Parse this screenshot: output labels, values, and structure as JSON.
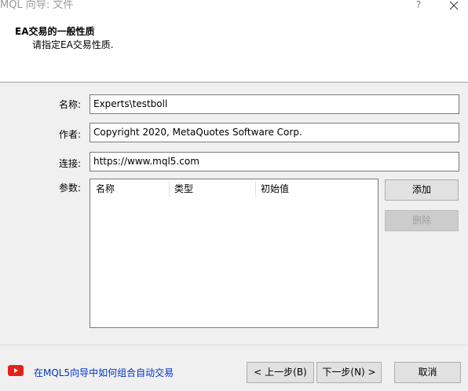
{
  "window": {
    "title": "MQL 向导: 文件",
    "help_glyph": "?"
  },
  "header": {
    "title": "EA交易的一般性质",
    "subtitle": "请指定EA交易性质."
  },
  "form": {
    "name_label": "名称:",
    "name_value": "Experts\\testboll",
    "author_label": "作者:",
    "author_value": "Copyright 2020, MetaQuotes Software Corp.",
    "link_label": "连接:",
    "link_value": "https://www.mql5.com",
    "params_label": "参数:"
  },
  "params_table": {
    "columns": [
      "名称",
      "类型",
      "初始值"
    ],
    "rows": []
  },
  "buttons": {
    "add": "添加",
    "delete": "删除",
    "back": "< 上一步(B)",
    "next": "下一步(N) >",
    "cancel": "取消"
  },
  "footer": {
    "help_link": "在MQL5向导中如何组合自动交易"
  },
  "colors": {
    "link": "#0033cc",
    "youtube": "#e62117"
  }
}
